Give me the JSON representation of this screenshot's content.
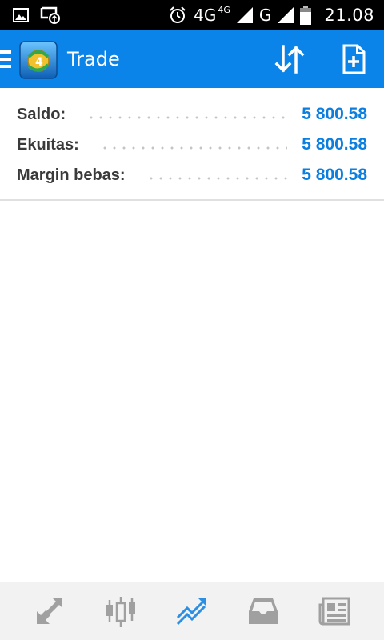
{
  "status_bar": {
    "icons": [
      "image-icon",
      "cast-icon",
      "alarm-icon",
      "signal-icon",
      "battery-icon"
    ],
    "network_primary": "4G",
    "network_superscript": "4G",
    "network_secondary": "G",
    "time": "21.08"
  },
  "app_bar": {
    "title": "Trade",
    "color": "#0a84e8",
    "icons": [
      "menu-icon",
      "app-logo-icon",
      "sort-icon",
      "new-order-icon"
    ]
  },
  "summary": {
    "rows": [
      {
        "label": "Saldo:",
        "value": "5 800.58"
      },
      {
        "label": "Ekuitas:",
        "value": "5 800.58"
      },
      {
        "label": "Margin bebas:",
        "value": "5 800.58"
      }
    ],
    "value_color": "#0a7fe0"
  },
  "bottom_nav": {
    "items": [
      {
        "name": "quotes",
        "icon": "arrows-icon"
      },
      {
        "name": "charts",
        "icon": "candlestick-icon"
      },
      {
        "name": "trade",
        "icon": "trend-icon",
        "active": true
      },
      {
        "name": "history",
        "icon": "inbox-icon"
      },
      {
        "name": "news",
        "icon": "newspaper-icon"
      }
    ],
    "active_color": "#2b8fe3",
    "inactive_color": "#9a9a9a"
  }
}
